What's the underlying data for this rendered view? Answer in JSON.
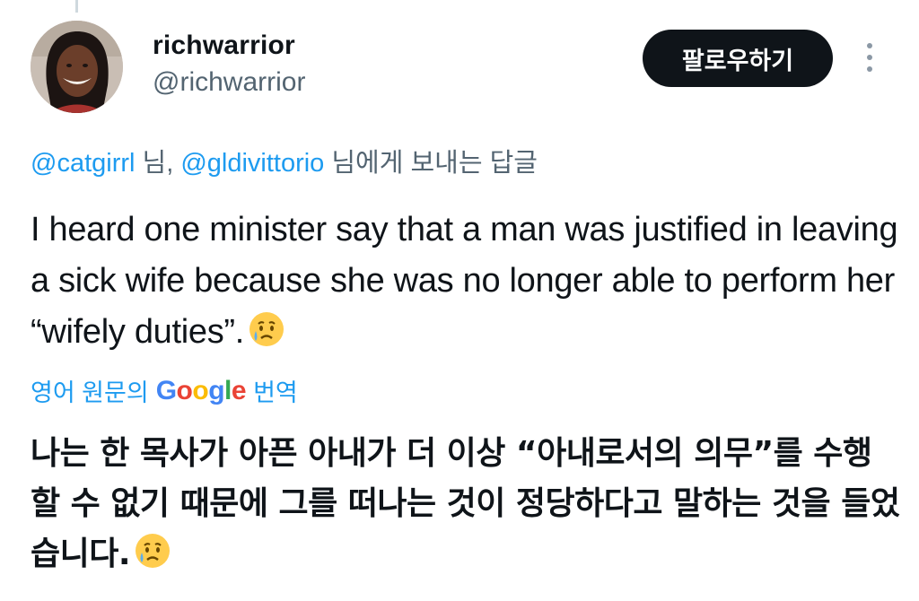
{
  "user": {
    "display_name": "richwarrior",
    "handle": "@richwarrior"
  },
  "follow_button_label": "팔로우하기",
  "more_icon": "more-vertical-icon",
  "reply_context": {
    "mention_1": "@catgirrl",
    "sep_1": " 님, ",
    "mention_2": "@gldivittorio",
    "suffix": " 님에게 보내는 답글"
  },
  "tweet": {
    "text": "I heard one minister say that a man was justified in leaving a sick wife because she was no longer able to perform her “wifely duties”.",
    "emoji": "crying-face-emoji"
  },
  "translation": {
    "prefix": "영어 원문의",
    "google": [
      "G",
      "o",
      "o",
      "g",
      "l",
      "e"
    ],
    "suffix": "번역",
    "text": "나는 한 목사가 아픈 아내가 더 이상 “아내로서의 의무”를 수행할 수 없기 때문에 그를 떠나는 것이 정당하다고 말하는 것을 들었습니다."
  },
  "colors": {
    "link": "#1d9bf0",
    "secondary_text": "#536471",
    "button_bg": "#0f1419"
  }
}
